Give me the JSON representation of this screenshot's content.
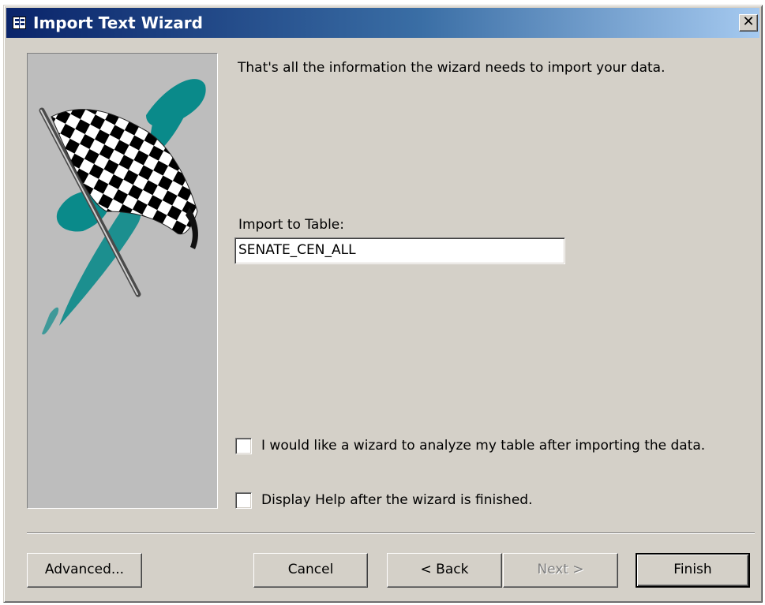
{
  "window": {
    "title": "Import Text Wizard",
    "title_icon": "table-grid-icon",
    "close_glyph": "✕"
  },
  "main": {
    "info_text": "That's all the information the wizard needs to import your data.",
    "import_label": "Import to Table:",
    "table_name": "SENATE_CEN_ALL"
  },
  "options": [
    {
      "label": "I would like a wizard to analyze my table after importing the data.",
      "checked": false
    },
    {
      "label": "Display Help after the wizard is finished.",
      "checked": false
    }
  ],
  "buttons": {
    "advanced": "Advanced...",
    "cancel": "Cancel",
    "back": "< Back",
    "next": "Next >",
    "finish": "Finish"
  },
  "image": {
    "icon": "checkered-flag-icon",
    "accent_color": "#0a8a8a"
  },
  "colors": {
    "title_gradient_start": "#0a246a",
    "title_gradient_end": "#a6caf0",
    "face": "#d4d0c8"
  }
}
